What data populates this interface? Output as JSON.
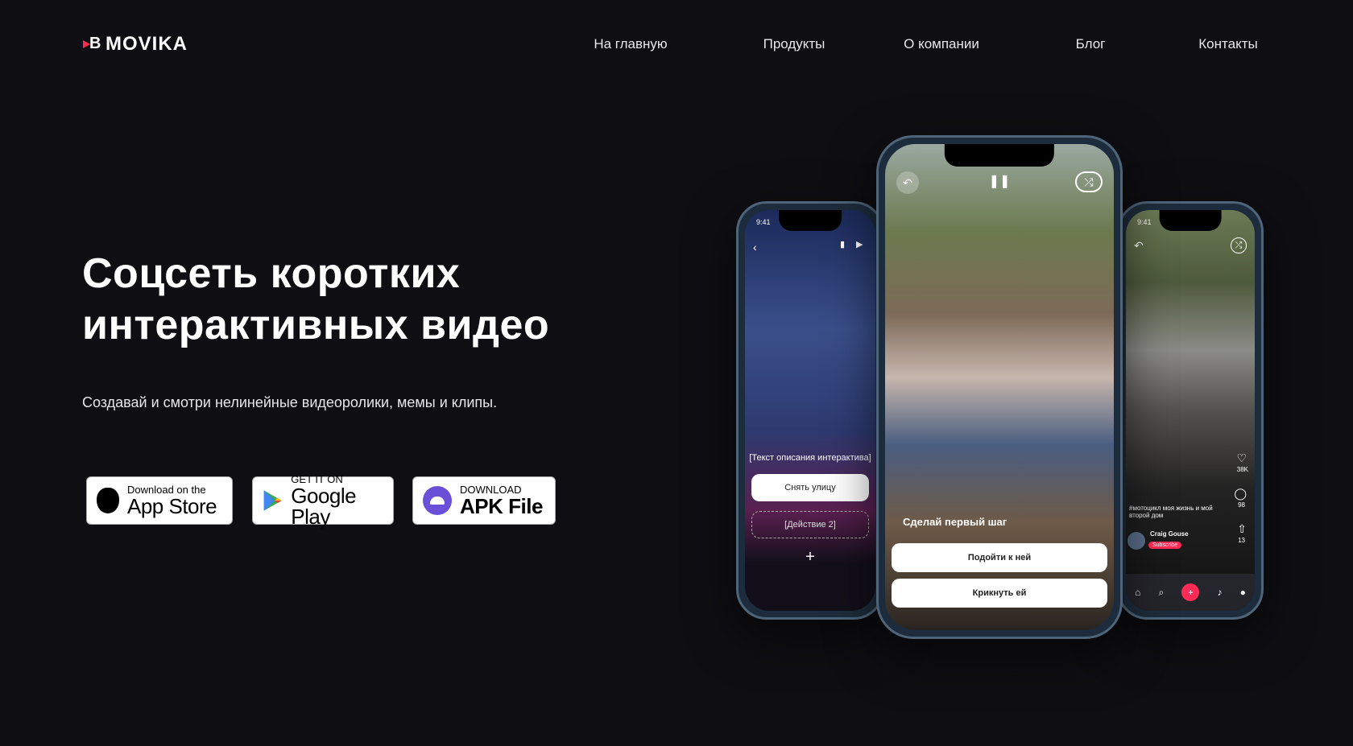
{
  "brand": {
    "name": "MOVIKA",
    "accent": "#ff2a55"
  },
  "nav": [
    {
      "label": "На главную"
    },
    {
      "label": "Продукты"
    },
    {
      "label": "О компании"
    },
    {
      "label": "Блог"
    },
    {
      "label": "Контакты"
    }
  ],
  "hero": {
    "title_line1": "Соцсеть коротких",
    "title_line2": "интерактивных видео",
    "subtitle": "Создавай и смотри нелинейные видеоролики, мемы и клипы."
  },
  "stores": {
    "appstore": {
      "small": "Download on the",
      "large": "App Store",
      "icon": "apple-icon"
    },
    "googleplay": {
      "small": "GET IT ON",
      "large": "Google Play",
      "icon": "google-play-icon"
    },
    "apk": {
      "small": "DOWNLOAD",
      "large": "APK File",
      "icon": "android-icon"
    }
  },
  "phones": {
    "left": {
      "time": "9:41",
      "caption": "[Текст описания интерактива]",
      "action1": "Снять улицу",
      "action2": "[Действие 2]",
      "add": "+"
    },
    "center": {
      "caption": "Сделай первый шаг",
      "action1": "Подойти к ней",
      "action2": "Крикнуть ей"
    },
    "right": {
      "time": "9:41",
      "hashtag": "#мотоцикл моя жизнь и мой второй дом",
      "user": "Craig Gouse",
      "subscribe": "Subscribe",
      "likes": "38K",
      "comments": "98",
      "shares": "13"
    }
  }
}
